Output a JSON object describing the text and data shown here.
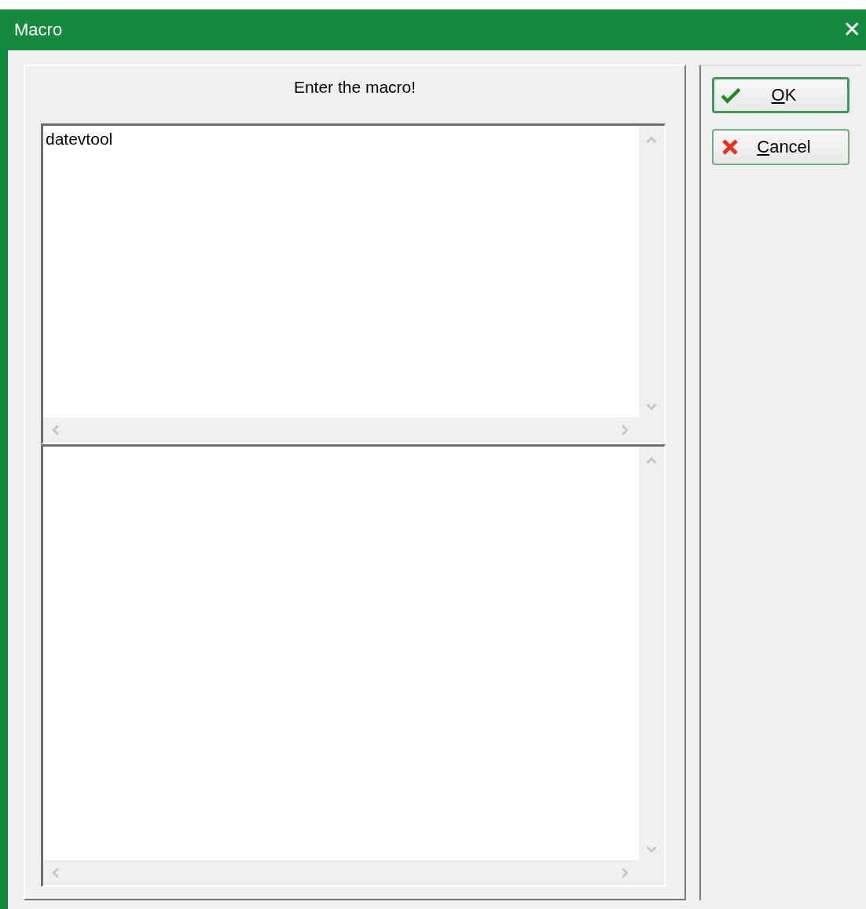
{
  "window": {
    "title": "Macro",
    "close": "✕"
  },
  "prompt": "Enter the macro!",
  "editors": [
    {
      "value": "datevtool"
    }
  ],
  "buttons": [
    {
      "label": "OK",
      "kind": "ok",
      "default": true
    },
    {
      "label": "Cancel",
      "kind": "cancel",
      "default": false
    }
  ]
}
